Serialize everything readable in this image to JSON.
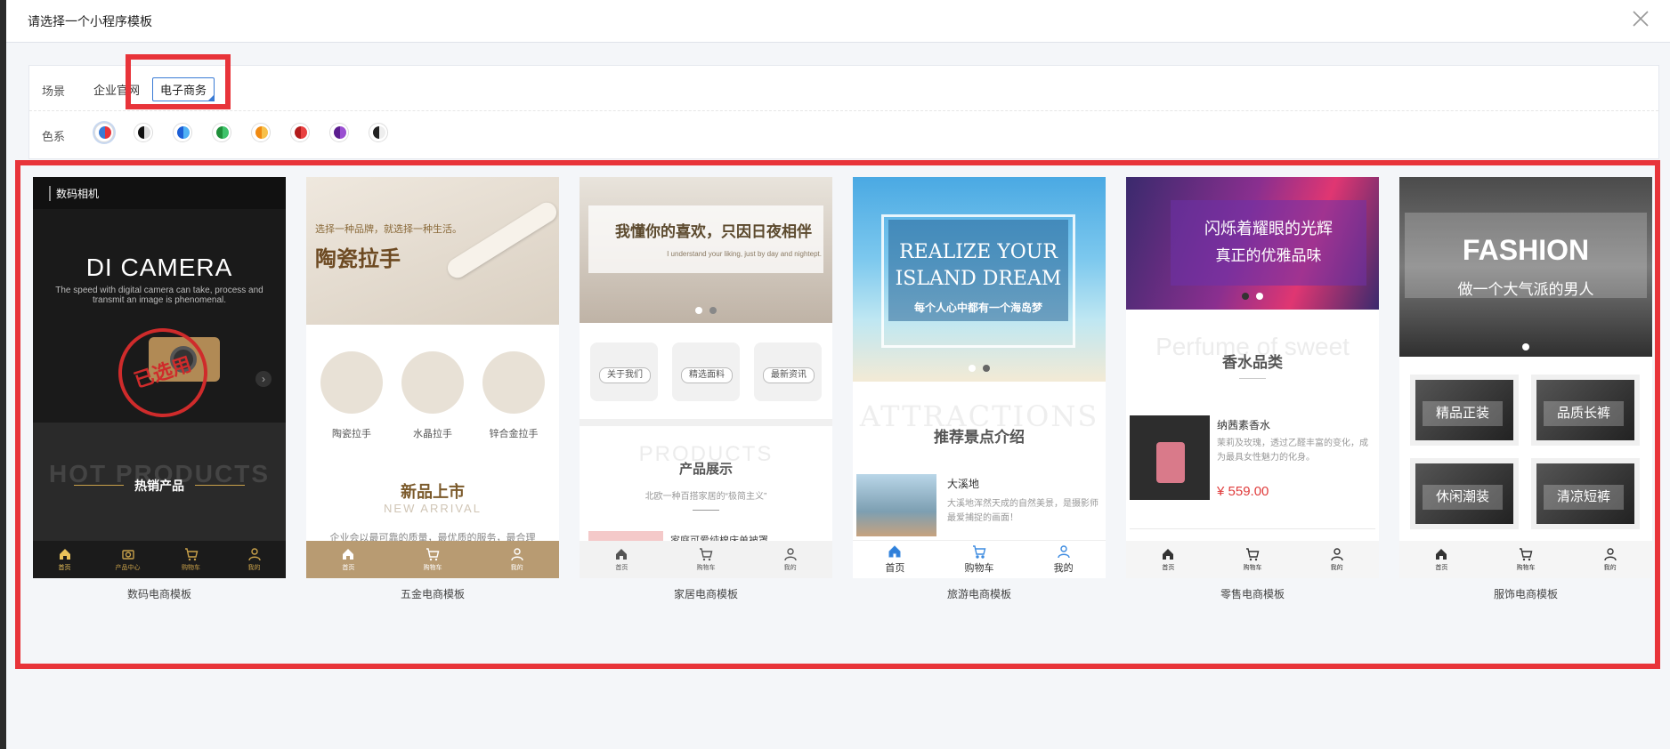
{
  "modal": {
    "title": "请选择一个小程序模板",
    "close_icon": "close-icon"
  },
  "filters": {
    "scene_label": "场景",
    "scene_options": [
      "企业官网",
      "电子商务"
    ],
    "scene_selected": "电子商务",
    "color_label": "色系",
    "color_swatches": [
      {
        "left": "#3a7bd5",
        "right": "#e8343a",
        "selected": true
      },
      {
        "left": "#111111",
        "right": "#dddddd"
      },
      {
        "left": "#1d5fd6",
        "right": "#4fb1f5"
      },
      {
        "left": "#1f8f3a",
        "right": "#3ec26a"
      },
      {
        "left": "#f08a12",
        "right": "#f7c04a"
      },
      {
        "left": "#b31c1c",
        "right": "#e84040"
      },
      {
        "left": "#5b1d8f",
        "right": "#9a4fd1"
      },
      {
        "left": "#222222",
        "right": "#eeeeee"
      }
    ]
  },
  "templates": [
    {
      "label": "数码电商模板",
      "logo": "数码相机",
      "headline": "DI CAMERA",
      "subline": "The speed with digital camera can take, process and transmit an image is phenomenal.",
      "stamp": "已选用",
      "ghost": "HOT PRODUCTS",
      "section": "热销产品",
      "tabs": [
        "首页",
        "产品中心",
        "购物车",
        "我的"
      ]
    },
    {
      "label": "五金电商模板",
      "slogan": "选择一种品牌，就选择一种生活。",
      "headline": "陶瓷拉手",
      "categories": [
        "陶瓷拉手",
        "水晶拉手",
        "锌合金拉手"
      ],
      "section": "新品上市",
      "section_en": "NEW ARRIVAL",
      "intro": "企业会以最可靠的质量，最优质的服务，最合理",
      "tabs": [
        "首页",
        "购物车",
        "我的"
      ]
    },
    {
      "label": "家居电商模板",
      "headline": "我懂你的喜欢，只因日夜相伴",
      "subline": "I understand your liking, just by day and nightept.",
      "quick_links": [
        "关于我们",
        "精选面料",
        "最新资讯"
      ],
      "ghost": "PRODUCTS",
      "section": "产品展示",
      "section_sub": "北欧一种百搭家居的“极简主义”",
      "item": "家庭可爱纯棉床单被罩",
      "tabs": [
        "首页",
        "购物车",
        "我的"
      ]
    },
    {
      "label": "旅游电商模板",
      "headline_1": "REALIZE YOUR",
      "headline_2": "ISLAND DREAM",
      "subline": "每个人心中都有一个海岛梦",
      "ghost": "ATTRACTIONS",
      "section": "推荐景点介绍",
      "item_name": "大溪地",
      "item_desc": "大溪地浑然天成的自然美景，是摄影师最爱捕捉的画面！",
      "tabs": [
        "首页",
        "购物车",
        "我的"
      ]
    },
    {
      "label": "零售电商模板",
      "headline_1": "闪烁着耀眼的光辉",
      "headline_2": "真正的优雅品味",
      "ghost": "Perfume of sweet",
      "section": "香水品类",
      "item_name": "纳茜素香水",
      "item_desc": "茉莉及玫瑰，透过乙醛丰富的变化，成为最具女性魅力的化身。",
      "price": "¥ 559.00",
      "tabs": [
        "首页",
        "购物车",
        "我的"
      ]
    },
    {
      "label": "服饰电商模板",
      "headline": "FASHION",
      "subline": "做一个大气派的男人",
      "tiles": [
        "精品正装",
        "品质长裤",
        "休闲潮装",
        "清凉短裤"
      ],
      "tabs": [
        "首页",
        "购物车",
        "我的"
      ]
    }
  ]
}
